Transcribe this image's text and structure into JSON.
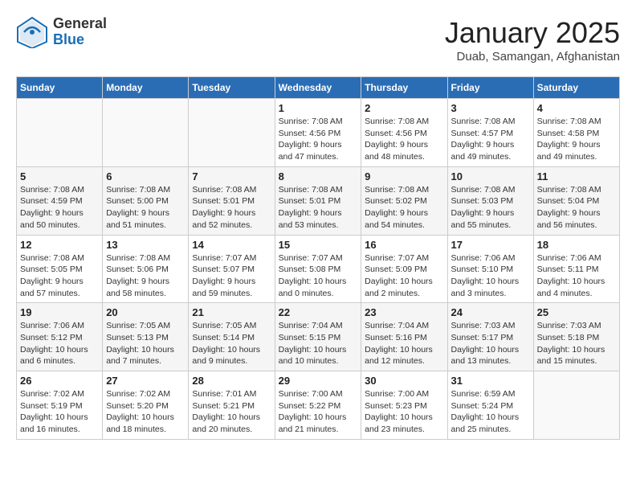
{
  "header": {
    "logo_general": "General",
    "logo_blue": "Blue",
    "month_title": "January 2025",
    "location": "Duab, Samangan, Afghanistan"
  },
  "weekdays": [
    "Sunday",
    "Monday",
    "Tuesday",
    "Wednesday",
    "Thursday",
    "Friday",
    "Saturday"
  ],
  "weeks": [
    [
      {
        "day": "",
        "info": ""
      },
      {
        "day": "",
        "info": ""
      },
      {
        "day": "",
        "info": ""
      },
      {
        "day": "1",
        "info": "Sunrise: 7:08 AM\nSunset: 4:56 PM\nDaylight: 9 hours\nand 47 minutes."
      },
      {
        "day": "2",
        "info": "Sunrise: 7:08 AM\nSunset: 4:56 PM\nDaylight: 9 hours\nand 48 minutes."
      },
      {
        "day": "3",
        "info": "Sunrise: 7:08 AM\nSunset: 4:57 PM\nDaylight: 9 hours\nand 49 minutes."
      },
      {
        "day": "4",
        "info": "Sunrise: 7:08 AM\nSunset: 4:58 PM\nDaylight: 9 hours\nand 49 minutes."
      }
    ],
    [
      {
        "day": "5",
        "info": "Sunrise: 7:08 AM\nSunset: 4:59 PM\nDaylight: 9 hours\nand 50 minutes."
      },
      {
        "day": "6",
        "info": "Sunrise: 7:08 AM\nSunset: 5:00 PM\nDaylight: 9 hours\nand 51 minutes."
      },
      {
        "day": "7",
        "info": "Sunrise: 7:08 AM\nSunset: 5:01 PM\nDaylight: 9 hours\nand 52 minutes."
      },
      {
        "day": "8",
        "info": "Sunrise: 7:08 AM\nSunset: 5:01 PM\nDaylight: 9 hours\nand 53 minutes."
      },
      {
        "day": "9",
        "info": "Sunrise: 7:08 AM\nSunset: 5:02 PM\nDaylight: 9 hours\nand 54 minutes."
      },
      {
        "day": "10",
        "info": "Sunrise: 7:08 AM\nSunset: 5:03 PM\nDaylight: 9 hours\nand 55 minutes."
      },
      {
        "day": "11",
        "info": "Sunrise: 7:08 AM\nSunset: 5:04 PM\nDaylight: 9 hours\nand 56 minutes."
      }
    ],
    [
      {
        "day": "12",
        "info": "Sunrise: 7:08 AM\nSunset: 5:05 PM\nDaylight: 9 hours\nand 57 minutes."
      },
      {
        "day": "13",
        "info": "Sunrise: 7:08 AM\nSunset: 5:06 PM\nDaylight: 9 hours\nand 58 minutes."
      },
      {
        "day": "14",
        "info": "Sunrise: 7:07 AM\nSunset: 5:07 PM\nDaylight: 9 hours\nand 59 minutes."
      },
      {
        "day": "15",
        "info": "Sunrise: 7:07 AM\nSunset: 5:08 PM\nDaylight: 10 hours\nand 0 minutes."
      },
      {
        "day": "16",
        "info": "Sunrise: 7:07 AM\nSunset: 5:09 PM\nDaylight: 10 hours\nand 2 minutes."
      },
      {
        "day": "17",
        "info": "Sunrise: 7:06 AM\nSunset: 5:10 PM\nDaylight: 10 hours\nand 3 minutes."
      },
      {
        "day": "18",
        "info": "Sunrise: 7:06 AM\nSunset: 5:11 PM\nDaylight: 10 hours\nand 4 minutes."
      }
    ],
    [
      {
        "day": "19",
        "info": "Sunrise: 7:06 AM\nSunset: 5:12 PM\nDaylight: 10 hours\nand 6 minutes."
      },
      {
        "day": "20",
        "info": "Sunrise: 7:05 AM\nSunset: 5:13 PM\nDaylight: 10 hours\nand 7 minutes."
      },
      {
        "day": "21",
        "info": "Sunrise: 7:05 AM\nSunset: 5:14 PM\nDaylight: 10 hours\nand 9 minutes."
      },
      {
        "day": "22",
        "info": "Sunrise: 7:04 AM\nSunset: 5:15 PM\nDaylight: 10 hours\nand 10 minutes."
      },
      {
        "day": "23",
        "info": "Sunrise: 7:04 AM\nSunset: 5:16 PM\nDaylight: 10 hours\nand 12 minutes."
      },
      {
        "day": "24",
        "info": "Sunrise: 7:03 AM\nSunset: 5:17 PM\nDaylight: 10 hours\nand 13 minutes."
      },
      {
        "day": "25",
        "info": "Sunrise: 7:03 AM\nSunset: 5:18 PM\nDaylight: 10 hours\nand 15 minutes."
      }
    ],
    [
      {
        "day": "26",
        "info": "Sunrise: 7:02 AM\nSunset: 5:19 PM\nDaylight: 10 hours\nand 16 minutes."
      },
      {
        "day": "27",
        "info": "Sunrise: 7:02 AM\nSunset: 5:20 PM\nDaylight: 10 hours\nand 18 minutes."
      },
      {
        "day": "28",
        "info": "Sunrise: 7:01 AM\nSunset: 5:21 PM\nDaylight: 10 hours\nand 20 minutes."
      },
      {
        "day": "29",
        "info": "Sunrise: 7:00 AM\nSunset: 5:22 PM\nDaylight: 10 hours\nand 21 minutes."
      },
      {
        "day": "30",
        "info": "Sunrise: 7:00 AM\nSunset: 5:23 PM\nDaylight: 10 hours\nand 23 minutes."
      },
      {
        "day": "31",
        "info": "Sunrise: 6:59 AM\nSunset: 5:24 PM\nDaylight: 10 hours\nand 25 minutes."
      },
      {
        "day": "",
        "info": ""
      }
    ]
  ]
}
